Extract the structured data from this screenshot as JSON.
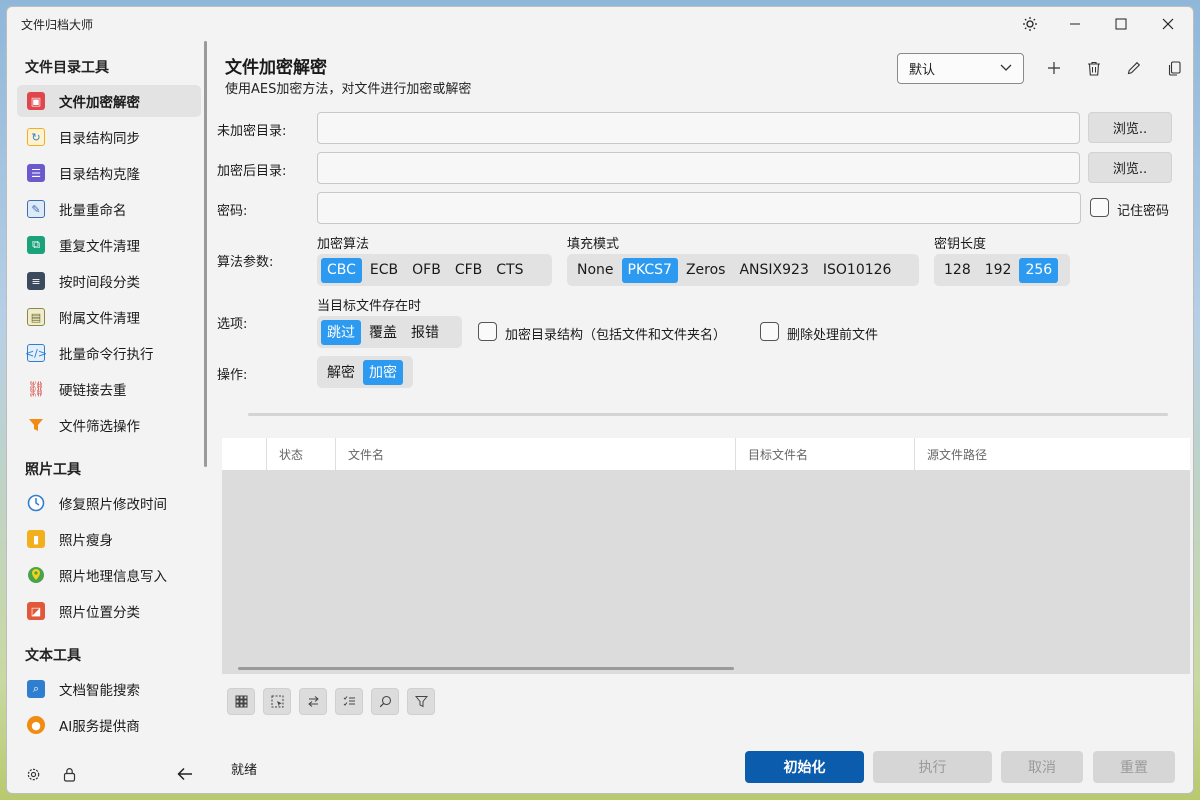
{
  "window": {
    "title": "文件归档大师"
  },
  "sidebar": {
    "sections": [
      {
        "title": "文件目录工具",
        "items": [
          {
            "label": "文件加密解密",
            "icon": "lock-file-icon",
            "color": "#e0474c",
            "active": true
          },
          {
            "label": "目录结构同步",
            "icon": "sync-folder-icon",
            "color": "#f2b01e"
          },
          {
            "label": "目录结构克隆",
            "icon": "list-clone-icon",
            "color": "#6a5acd"
          },
          {
            "label": "批量重命名",
            "icon": "pencil-rename-icon",
            "color": "#3a6fb5"
          },
          {
            "label": "重复文件清理",
            "icon": "duplicate-clean-icon",
            "color": "#1aa37a"
          },
          {
            "label": "按时间段分类",
            "icon": "time-classify-icon",
            "color": "#3b4a5c"
          },
          {
            "label": "附属文件清理",
            "icon": "attachment-clean-icon",
            "color": "#8a8a40"
          },
          {
            "label": "批量命令行执行",
            "icon": "code-command-icon",
            "color": "#2f7fd1"
          },
          {
            "label": "硬链接去重",
            "icon": "link-icon",
            "color": "#d9413b"
          },
          {
            "label": "文件筛选操作",
            "icon": "funnel-filter-icon",
            "color": "#f08c12"
          }
        ]
      },
      {
        "title": "照片工具",
        "items": [
          {
            "label": "修复照片修改时间",
            "icon": "clock-fix-icon",
            "color": "#2f7fd1"
          },
          {
            "label": "照片瘦身",
            "icon": "zip-compress-icon",
            "color": "#f2b01e"
          },
          {
            "label": "照片地理信息写入",
            "icon": "map-pin-icon",
            "color": "#4aa34a"
          },
          {
            "label": "照片位置分类",
            "icon": "map-classify-icon",
            "color": "#e2583a"
          }
        ]
      },
      {
        "title": "文本工具",
        "items": [
          {
            "label": "文档智能搜索",
            "icon": "doc-search-icon",
            "color": "#2f7fd1"
          },
          {
            "label": "AI服务提供商",
            "icon": "ai-brain-icon",
            "color": "#f08c12"
          }
        ]
      }
    ]
  },
  "main": {
    "title": "文件加密解密",
    "subtitle": "使用AES加密方法，对文件进行加密或解密",
    "preset": "默认",
    "labels": {
      "src_dir": "未加密目录:",
      "dst_dir": "加密后目录:",
      "password": "密码:",
      "algo_params": "算法参数:",
      "options": "选项:",
      "operation": "操作:"
    },
    "browse": "浏览..",
    "remember_password": "记住密码",
    "src_value": "",
    "dst_value": "",
    "password_value": "",
    "cipher_mode": {
      "title": "加密算法",
      "options": [
        "CBC",
        "ECB",
        "OFB",
        "CFB",
        "CTS"
      ],
      "selected": "CBC"
    },
    "padding": {
      "title": "填充模式",
      "options": [
        "None",
        "PKCS7",
        "Zeros",
        "ANSIX923",
        "ISO10126"
      ],
      "selected": "PKCS7"
    },
    "key_length": {
      "title": "密钥长度",
      "options": [
        "128",
        "192",
        "256"
      ],
      "selected": "256"
    },
    "exists": {
      "title": "当目标文件存在时",
      "options": [
        "跳过",
        "覆盖",
        "报错"
      ],
      "selected": "跳过"
    },
    "encrypt_structure": "加密目录结构（包括文件和文件夹名）",
    "delete_before": "删除处理前文件",
    "operation_opts": {
      "options": [
        "解密",
        "加密"
      ],
      "selected": "解密"
    },
    "table": {
      "columns": [
        "",
        "状态",
        "文件名",
        "目标文件名",
        "源文件路径"
      ]
    },
    "status": "就绪",
    "buttons": {
      "init": "初始化",
      "run": "执行",
      "cancel": "取消",
      "reset": "重置"
    }
  }
}
